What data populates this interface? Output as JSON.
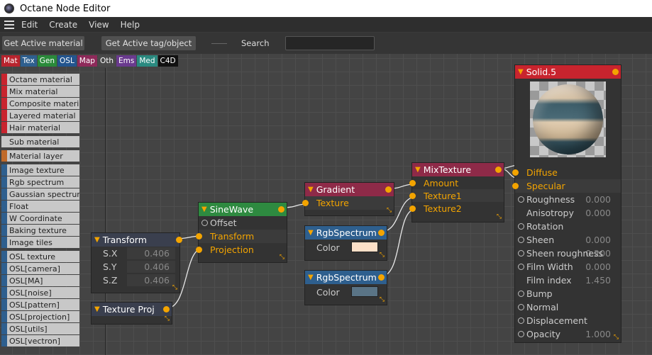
{
  "window": {
    "title": "Octane Node Editor"
  },
  "menu": {
    "items": [
      "Edit",
      "Create",
      "View",
      "Help"
    ]
  },
  "toolbar": {
    "get_active_material": "Get Active material",
    "get_active_tag": "Get Active tag/object",
    "search_label": "Search",
    "search_value": ""
  },
  "category_tabs": [
    {
      "label": "Mat",
      "color": "#b8242e"
    },
    {
      "label": "Tex",
      "color": "#2e5f8e"
    },
    {
      "label": "Gen",
      "color": "#2a8a3a"
    },
    {
      "label": "OSL",
      "color": "#23558e"
    },
    {
      "label": "Map",
      "color": "#8e2a5a"
    },
    {
      "label": "Oth",
      "color": "#4a4a4a"
    },
    {
      "label": "Ems",
      "color": "#6a3a8e"
    },
    {
      "label": "Med",
      "color": "#2a8a80"
    },
    {
      "label": "C4D",
      "color": "#111111"
    }
  ],
  "palette": [
    {
      "label": "Octane material",
      "color": "#c8242e"
    },
    {
      "label": "Mix material",
      "color": "#c8242e"
    },
    {
      "label": "Composite material",
      "color": "#c8242e"
    },
    {
      "label": "Layered material",
      "color": "#c8242e"
    },
    {
      "label": "Hair material",
      "color": "#c8242e"
    },
    {
      "label": "Sub material",
      "color": "#c8c8c8",
      "gap": true
    },
    {
      "label": "Material layer",
      "color": "#c06a2a",
      "gap": true
    },
    {
      "label": "Image texture",
      "color": "#2e5f8e",
      "gap": true
    },
    {
      "label": "Rgb spectrum",
      "color": "#2e5f8e"
    },
    {
      "label": "Gaussian spectrum",
      "color": "#2e5f8e"
    },
    {
      "label": "Float",
      "color": "#2e5f8e"
    },
    {
      "label": "W Coordinate",
      "color": "#2e5f8e"
    },
    {
      "label": "Baking texture",
      "color": "#2e5f8e"
    },
    {
      "label": "Image tiles",
      "color": "#2e5f8e"
    },
    {
      "label": "OSL texture",
      "color": "#2e5f8e",
      "gap": true
    },
    {
      "label": "OSL[camera]",
      "color": "#2e5f8e"
    },
    {
      "label": "OSL[MA]",
      "color": "#2e5f8e"
    },
    {
      "label": "OSL[noise]",
      "color": "#2e5f8e"
    },
    {
      "label": "OSL[pattern]",
      "color": "#2e5f8e"
    },
    {
      "label": "OSL[projection]",
      "color": "#2e5f8e"
    },
    {
      "label": "OSL[utils]",
      "color": "#2e5f8e"
    },
    {
      "label": "OSL[vectron]",
      "color": "#2e5f8e"
    }
  ],
  "nodes": {
    "transform": {
      "title": "Transform",
      "header_color": "#3a3f4e",
      "sx_label": "S.X",
      "sx": "0.406",
      "sy_label": "S.Y",
      "sy": "0.406",
      "sz_label": "S.Z",
      "sz": "0.406"
    },
    "texture_proj": {
      "title": "Texture Proj",
      "header_color": "#3a3f4e"
    },
    "sinewave": {
      "title": "SineWave",
      "header_color": "#2e8a40",
      "offset": "Offset",
      "transform": "Transform",
      "projection": "Projection"
    },
    "gradient": {
      "title": "Gradient",
      "header_color": "#8e2a48",
      "texture": "Texture"
    },
    "rgb1": {
      "title": "RgbSpectrum",
      "header_color": "#2e5f8e",
      "color_label": "Color",
      "swatch": "#fde0c8"
    },
    "rgb2": {
      "title": "RgbSpectrum",
      "header_color": "#2e5f8e",
      "color_label": "Color",
      "swatch": "#5a7486"
    },
    "mixtexture": {
      "title": "MixTexture",
      "header_color": "#8e2a48",
      "amount": "Amount",
      "texture1": "Texture1",
      "texture2": "Texture2"
    },
    "solid": {
      "title": "Solid.5",
      "header_color": "#c8242e",
      "diffuse": "Diffuse",
      "specular": "Specular",
      "roughness": "Roughness",
      "roughness_val": "0.000",
      "anisotropy": "Anisotropy",
      "anisotropy_val": "0.000",
      "rotation": "Rotation",
      "sheen": "Sheen",
      "sheen_val": "0.000",
      "sheen_roughness": "Sheen roughness",
      "sheen_roughness_val": "0.200",
      "film_width": "Film Width",
      "film_width_val": "0.000",
      "film_index": "Film index",
      "film_index_val": "1.450",
      "bump": "Bump",
      "normal": "Normal",
      "displacement": "Displacement",
      "opacity": "Opacity",
      "opacity_val": "1.000"
    }
  }
}
